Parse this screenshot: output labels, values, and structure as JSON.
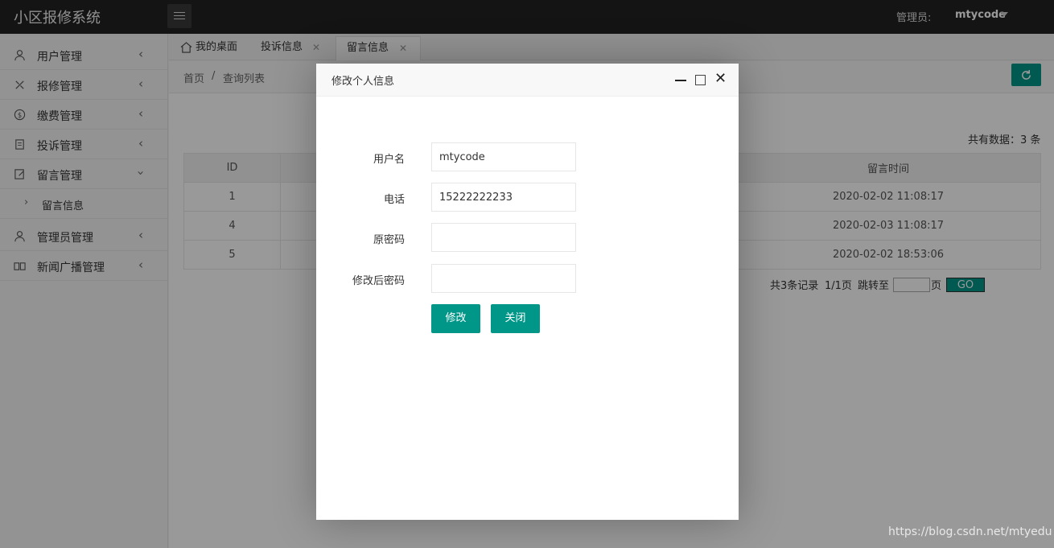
{
  "app": {
    "title": "小区报修系统"
  },
  "header": {
    "admin_label": "管理员:",
    "admin_name": "mtycode"
  },
  "sidebar": {
    "items": [
      {
        "label": "用户管理",
        "icon": "user-icon"
      },
      {
        "label": "报修管理",
        "icon": "tools-icon"
      },
      {
        "label": "缴费管理",
        "icon": "dollar-icon"
      },
      {
        "label": "投诉管理",
        "icon": "clipboard-icon"
      },
      {
        "label": "留言管理",
        "icon": "edit-icon"
      },
      {
        "label": "管理员管理",
        "icon": "person-icon"
      },
      {
        "label": "新闻广播管理",
        "icon": "book-icon"
      }
    ],
    "sub_item": {
      "label": "留言信息"
    }
  },
  "tabs": [
    {
      "label": "我的桌面"
    },
    {
      "label": "投诉信息"
    },
    {
      "label": "留言信息"
    }
  ],
  "breadcrumb": {
    "home": "首页",
    "separator": "/",
    "current": "查询列表"
  },
  "count_text": "共有数据：3 条",
  "table": {
    "headers": {
      "id": "ID",
      "time": "留言时间"
    },
    "rows": [
      {
        "id": "1",
        "time": "2020-02-02 11:08:17"
      },
      {
        "id": "4",
        "time": "2020-02-03 11:08:17"
      },
      {
        "id": "5",
        "time": "2020-02-02 18:53:06"
      }
    ]
  },
  "pager": {
    "records": "共3条记录",
    "pages": "1/1页",
    "jump": "跳转至",
    "page_unit": "页",
    "go": "GO"
  },
  "modal": {
    "title": "修改个人信息",
    "fields": {
      "username_label": "用户名",
      "username_value": "mtycode",
      "phone_label": "电话",
      "phone_value": "15222222233",
      "old_pwd_label": "原密码",
      "new_pwd_label": "修改后密码"
    },
    "submit": "修改",
    "close": "关闭"
  },
  "watermark": "https://blog.csdn.net/mtyedu",
  "colors": {
    "accent": "#009688",
    "header_bg": "#222222"
  }
}
